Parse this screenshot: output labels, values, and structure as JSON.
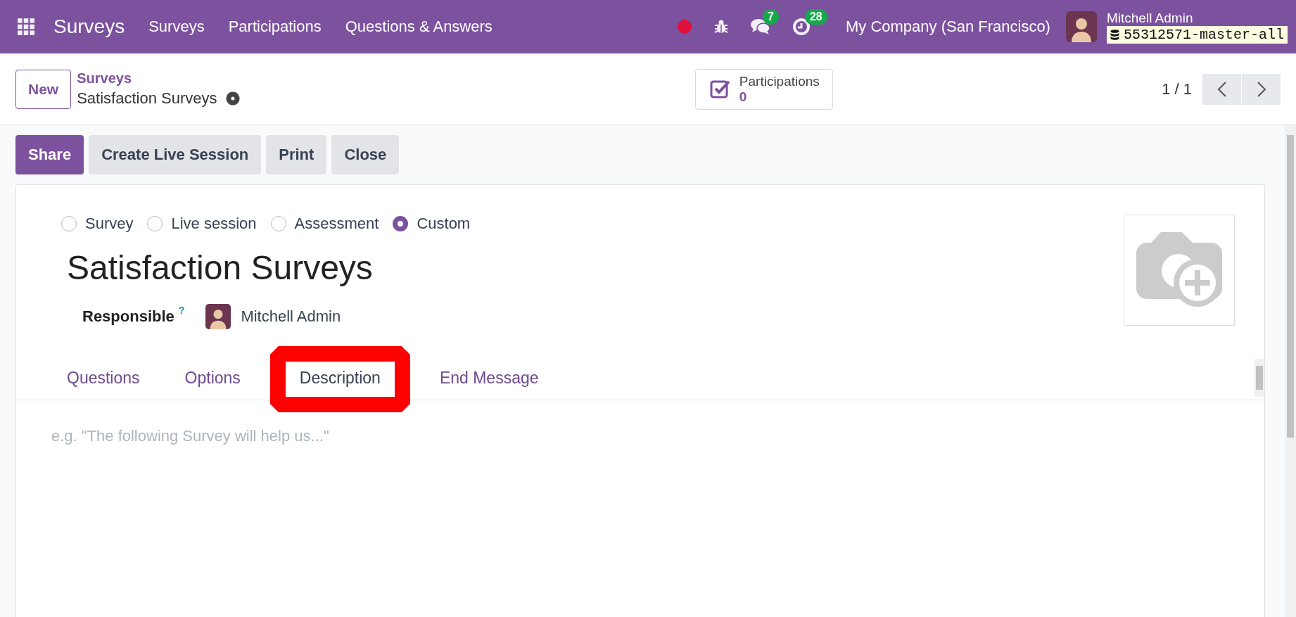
{
  "navbar": {
    "app_name": "Surveys",
    "menu": [
      "Surveys",
      "Participations",
      "Questions & Answers"
    ],
    "messages_badge": "7",
    "activities_badge": "28",
    "company": "My Company (San Francisco)",
    "user": "Mitchell Admin",
    "database": "55312571-master-all"
  },
  "control_panel": {
    "new_button": "New",
    "breadcrumb": "Surveys",
    "record_title": "Satisfaction Surveys",
    "smart_button": {
      "label": "Participations",
      "value": "0"
    },
    "pager": "1 / 1"
  },
  "actions": [
    {
      "label": "Share",
      "primary": true
    },
    {
      "label": "Create Live Session",
      "primary": false
    },
    {
      "label": "Print",
      "primary": false
    },
    {
      "label": "Close",
      "primary": false
    }
  ],
  "form": {
    "survey_types": [
      {
        "label": "Survey",
        "selected": false
      },
      {
        "label": "Live session",
        "selected": false
      },
      {
        "label": "Assessment",
        "selected": false
      },
      {
        "label": "Custom",
        "selected": true
      }
    ],
    "title": "Satisfaction Surveys",
    "responsible_label": "Responsible",
    "help_mark": "?",
    "responsible": "Mitchell Admin",
    "tabs": [
      {
        "label": "Questions",
        "selected": false,
        "highlighted": false
      },
      {
        "label": "Options",
        "selected": false,
        "highlighted": false
      },
      {
        "label": "Description",
        "selected": true,
        "highlighted": true
      },
      {
        "label": "End Message",
        "selected": false,
        "highlighted": false
      }
    ],
    "description_placeholder": "e.g. \"The following Survey will help us...\""
  }
}
